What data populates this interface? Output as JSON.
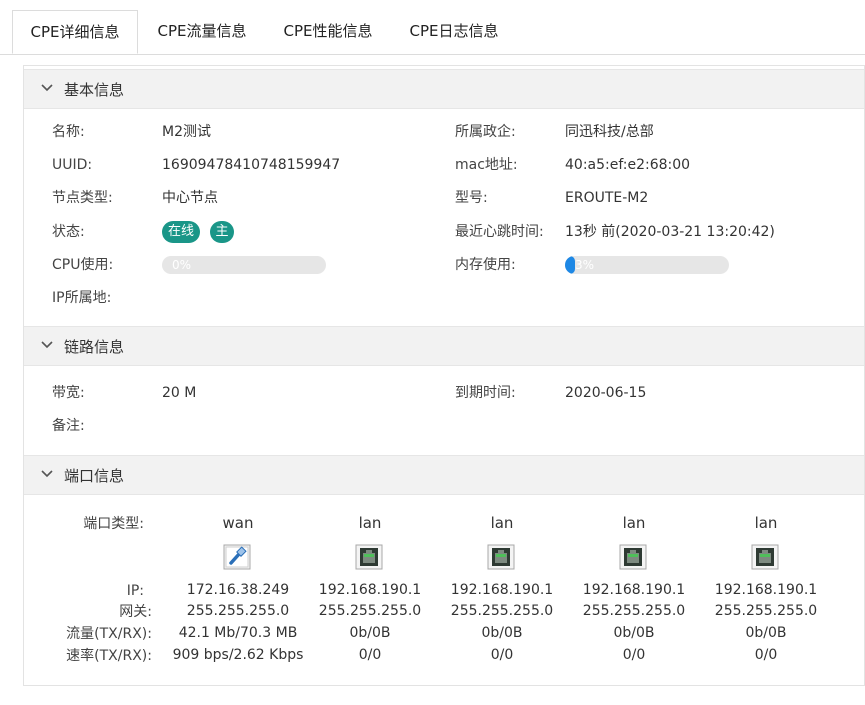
{
  "tabs": [
    "CPE详细信息",
    "CPE流量信息",
    "CPE性能信息",
    "CPE日志信息"
  ],
  "basic": {
    "title": "基本信息",
    "name_label": "名称:",
    "name": "M2测试",
    "uuid_label": "UUID:",
    "uuid": "16909478410748159947",
    "node_type_label": "节点类型:",
    "node_type": "中心节点",
    "status_label": "状态:",
    "status_online": "在线",
    "status_role": "主",
    "cpu_label": "CPU使用:",
    "cpu_text": "0%",
    "cpu_percent": 0,
    "ip_location_label": "IP所属地:",
    "org_label": "所属政企:",
    "org": "同迅科技/总部",
    "mac_label": "mac地址:",
    "mac": "40:a5:ef:e2:68:00",
    "model_label": "型号:",
    "model": "EROUTE-M2",
    "heartbeat_label": "最近心跳时间:",
    "heartbeat": "13秒 前(2020-03-21 13:20:42)",
    "mem_label": "内存使用:",
    "mem_text": "3%",
    "mem_percent": 3
  },
  "link": {
    "title": "链路信息",
    "bandwidth_label": "带宽:",
    "bandwidth": "20 M",
    "remark_label": "备注:",
    "expire_label": "到期时间:",
    "expire": "2020-06-15"
  },
  "ports": {
    "title": "端口信息",
    "labels": {
      "type": "端口类型:",
      "ip": "IP:",
      "gateway": "网关:",
      "traffic": "流量(TX/RX):",
      "rate": "速率(TX/RX):"
    },
    "items": [
      {
        "type": "wan",
        "ip": "172.16.38.249",
        "gateway": "255.255.255.0",
        "traffic": "42.1 Mb/70.3 MB",
        "rate": "909 bps/2.62 Kbps"
      },
      {
        "type": "lan",
        "ip": "192.168.190.1",
        "gateway": "255.255.255.0",
        "traffic": "0b/0B",
        "rate": "0/0"
      },
      {
        "type": "lan",
        "ip": "192.168.190.1",
        "gateway": "255.255.255.0",
        "traffic": "0b/0B",
        "rate": "0/0"
      },
      {
        "type": "lan",
        "ip": "192.168.190.1",
        "gateway": "255.255.255.0",
        "traffic": "0b/0B",
        "rate": "0/0"
      },
      {
        "type": "lan",
        "ip": "192.168.190.1",
        "gateway": "255.255.255.0",
        "traffic": "0b/0B",
        "rate": "0/0"
      }
    ]
  },
  "colors": {
    "badge": "#1a9688",
    "progress_fill": "#1e88e5",
    "progress_track": "#e6e6e6"
  }
}
